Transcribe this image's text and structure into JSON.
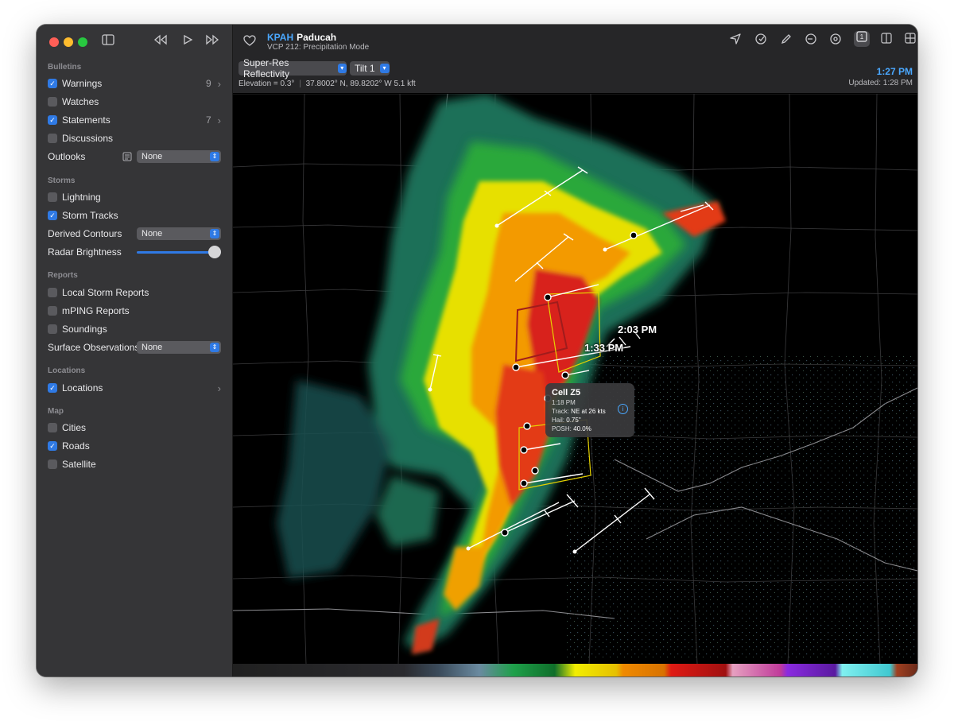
{
  "sidebar": {
    "sections": {
      "bulletins": "Bulletins",
      "storms": "Storms",
      "reports": "Reports",
      "locations": "Locations",
      "map": "Map"
    },
    "warnings": {
      "label": "Warnings",
      "checked": true,
      "count": "9"
    },
    "watches": {
      "label": "Watches",
      "checked": false
    },
    "statements": {
      "label": "Statements",
      "checked": true,
      "count": "7"
    },
    "discussions": {
      "label": "Discussions",
      "checked": false
    },
    "outlooks": {
      "label": "Outlooks",
      "value": "None"
    },
    "lightning": {
      "label": "Lightning",
      "checked": false
    },
    "storm_tracks": {
      "label": "Storm Tracks",
      "checked": true
    },
    "derived_contours": {
      "label": "Derived Contours",
      "value": "None"
    },
    "radar_brightness": {
      "label": "Radar Brightness",
      "level": 1.0
    },
    "local_storm_reports": {
      "label": "Local Storm Reports",
      "checked": false
    },
    "mping_reports": {
      "label": "mPING Reports",
      "checked": false
    },
    "soundings": {
      "label": "Soundings",
      "checked": false
    },
    "surface_observations": {
      "label": "Surface Observations",
      "value": "None"
    },
    "locations_item": {
      "label": "Locations",
      "checked": true
    },
    "cities": {
      "label": "Cities",
      "checked": false
    },
    "roads": {
      "label": "Roads",
      "checked": true
    },
    "satellite": {
      "label": "Satellite",
      "checked": false
    }
  },
  "header": {
    "station_code": "KPAH",
    "station_name": "Paducah",
    "mode": "VCP 212: Precipitation Mode"
  },
  "controls": {
    "product": "Super-Res Reflectivity",
    "tilt": "Tilt 1",
    "elevation": "Elevation = 0.3°",
    "coordinates": "37.8002° N, 89.8202° W 5.1 kft",
    "time": "1:27 PM",
    "updated": "Updated: 1:28 PM"
  },
  "map": {
    "track_labels": [
      "2:03 PM",
      "1:33 PM"
    ],
    "cell_popup": {
      "title": "Cell Z5",
      "time": "1:18 PM",
      "track_label": "Track:",
      "track_value": "NE at 26 kts",
      "hail_label": "Hail:",
      "hail_value": "0.75\"",
      "posh_label": "POSH:",
      "posh_value": "40.0%"
    }
  },
  "icons": {
    "sidebar_toggle": "sidebar-icon",
    "rewind": "rewind-icon",
    "play": "play-icon",
    "fast_forward": "fast-forward-icon",
    "favorite": "heart-icon"
  },
  "colors": {
    "accent": "#2f7ae5",
    "link": "#4aa8ff",
    "warning_polygon": "#a01c1c",
    "statement_polygon": "#e6d200"
  }
}
